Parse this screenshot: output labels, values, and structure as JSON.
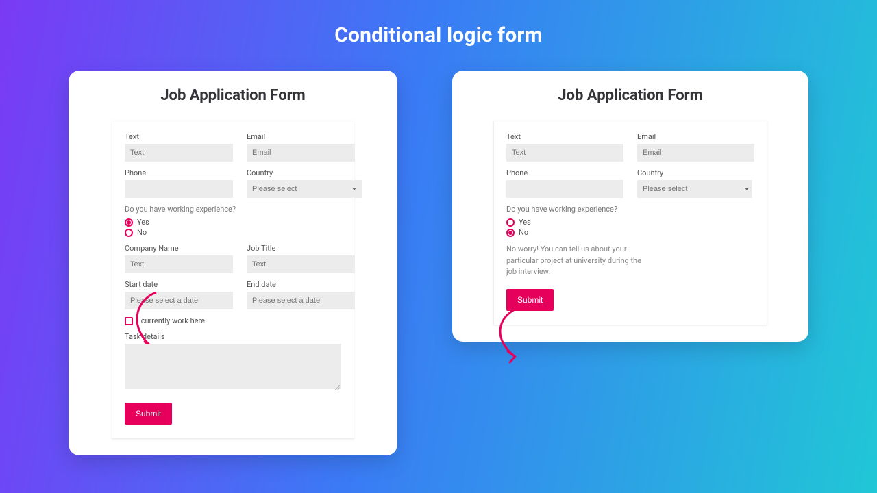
{
  "page": {
    "title": "Conditional logic form"
  },
  "colors": {
    "accent": "#e6005c"
  },
  "formA": {
    "title": "Job Application Form",
    "fields": {
      "text": {
        "label": "Text",
        "placeholder": "Text"
      },
      "email": {
        "label": "Email",
        "placeholder": "Email"
      },
      "phone": {
        "label": "Phone",
        "placeholder": ""
      },
      "country": {
        "label": "Country",
        "placeholder": "Please select"
      },
      "company": {
        "label": "Company Name",
        "placeholder": "Text"
      },
      "jobtitle": {
        "label": "Job Title",
        "placeholder": "Text"
      },
      "startdate": {
        "label": "Start date",
        "placeholder": "Please select a date"
      },
      "enddate": {
        "label": "End date",
        "placeholder": "Please select a date"
      },
      "taskdetails": {
        "label": "Task details"
      }
    },
    "experience": {
      "question": "Do you have working experience?",
      "options": {
        "yes": "Yes",
        "no": "No"
      },
      "selected": "yes"
    },
    "checkbox": {
      "label": "I currently work here."
    },
    "submit": "Submit"
  },
  "formB": {
    "title": "Job Application Form",
    "fields": {
      "text": {
        "label": "Text",
        "placeholder": "Text"
      },
      "email": {
        "label": "Email",
        "placeholder": "Email"
      },
      "phone": {
        "label": "Phone",
        "placeholder": ""
      },
      "country": {
        "label": "Country",
        "placeholder": "Please select"
      }
    },
    "experience": {
      "question": "Do you have working experience?",
      "options": {
        "yes": "Yes",
        "no": "No"
      },
      "selected": "no"
    },
    "note": "No worry! You can tell us about your particular project at university during the job interview.",
    "submit": "Submit"
  }
}
